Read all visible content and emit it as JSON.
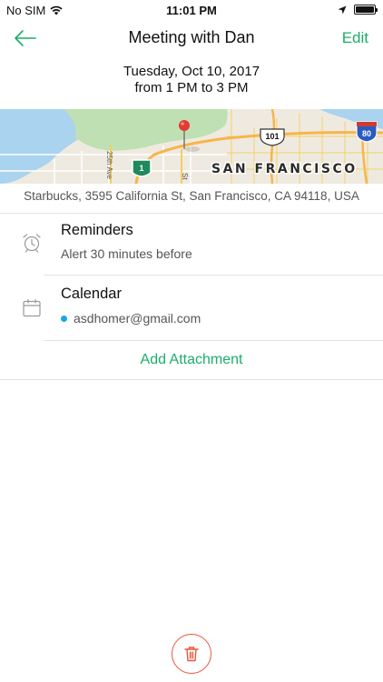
{
  "status_bar": {
    "carrier": "No SIM",
    "time": "11:01 PM",
    "icons": [
      "wifi-icon",
      "location-arrow-icon",
      "battery-icon"
    ],
    "battery_level": 1.0
  },
  "nav": {
    "back_icon": "arrow-left-icon",
    "title": "Meeting with Dan",
    "edit_label": "Edit"
  },
  "event": {
    "date": "Tuesday, Oct 10, 2017",
    "time_range": "from 1 PM to 3 PM"
  },
  "map": {
    "labels": {
      "highway_1": "1",
      "highway_101": "101",
      "interstate_80": "80",
      "street_25th": "25th Ave",
      "street_st": "St",
      "city": "SAN FRANCISCO"
    }
  },
  "location": {
    "address": "Starbucks, 3595 California St, San Francisco, CA 94118, USA"
  },
  "reminders": {
    "icon": "alarm-clock-icon",
    "title": "Reminders",
    "detail": "Alert 30 minutes before"
  },
  "calendar": {
    "icon": "calendar-icon",
    "title": "Calendar",
    "account": "asdhomer@gmail.com",
    "account_color": "#1aa7e8"
  },
  "actions": {
    "add_attachment": "Add Attachment",
    "delete_icon": "trash-icon"
  },
  "colors": {
    "accent": "#1cae6a",
    "destructive": "#e8563a"
  }
}
